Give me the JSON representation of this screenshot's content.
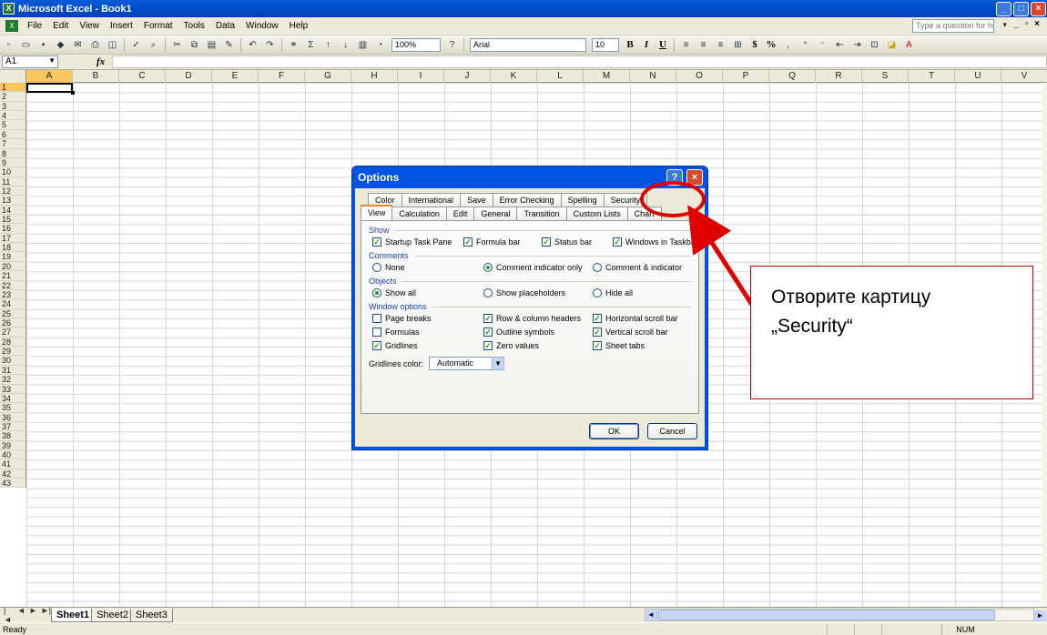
{
  "window": {
    "title": "Microsoft Excel - Book1",
    "app_icon": "X"
  },
  "menu": {
    "items": [
      "File",
      "Edit",
      "View",
      "Insert",
      "Format",
      "Tools",
      "Data",
      "Window",
      "Help"
    ],
    "ask_placeholder": "Type a question for help"
  },
  "toolbar": {
    "zoom": "100%",
    "font": "Arial",
    "size": "10",
    "bold": "B",
    "italic": "I",
    "underline": "U",
    "currency": "$",
    "percent": "%"
  },
  "formula": {
    "cell_ref": "A1",
    "fx": "fx"
  },
  "grid": {
    "columns": [
      "A",
      "B",
      "C",
      "D",
      "E",
      "F",
      "G",
      "H",
      "I",
      "J",
      "K",
      "L",
      "M",
      "N",
      "O",
      "P",
      "Q",
      "R",
      "S",
      "T",
      "U",
      "V"
    ],
    "rows": [
      "1",
      "2",
      "3",
      "4",
      "5",
      "6",
      "7",
      "8",
      "9",
      "10",
      "11",
      "12",
      "13",
      "14",
      "15",
      "16",
      "17",
      "18",
      "19",
      "20",
      "21",
      "22",
      "23",
      "24",
      "25",
      "26",
      "27",
      "28",
      "29",
      "30",
      "31",
      "32",
      "33",
      "34",
      "35",
      "36",
      "37",
      "38",
      "39",
      "40",
      "41",
      "42",
      "43"
    ]
  },
  "sheets": {
    "tabs": [
      "Sheet1",
      "Sheet2",
      "Sheet3"
    ],
    "active": "Sheet1"
  },
  "status": {
    "left": "Ready",
    "num": "NUM"
  },
  "dialog": {
    "title": "Options",
    "tabs_back": [
      "Color",
      "International",
      "Save",
      "Error Checking",
      "Spelling",
      "Security"
    ],
    "tabs_front": [
      "View",
      "Calculation",
      "Edit",
      "General",
      "Transition",
      "Custom Lists",
      "Chart"
    ],
    "show": {
      "label": "Show",
      "startup": "Startup Task Pane",
      "formula_bar": "Formula bar",
      "status_bar": "Status bar",
      "windows_taskbar": "Windows in Taskbar"
    },
    "comments": {
      "label": "Comments",
      "none": "None",
      "indicator_only": "Comment indicator only",
      "comment_indicator": "Comment & indicator"
    },
    "objects": {
      "label": "Objects",
      "show_all": "Show all",
      "placeholders": "Show placeholders",
      "hide_all": "Hide all"
    },
    "window_options": {
      "label": "Window options",
      "page_breaks": "Page breaks",
      "formulas": "Formulas",
      "gridlines": "Gridlines",
      "row_col_headers": "Row & column headers",
      "outline": "Outline symbols",
      "zero_values": "Zero values",
      "h_scroll": "Horizontal scroll bar",
      "v_scroll": "Vertical scroll bar",
      "sheet_tabs": "Sheet tabs"
    },
    "gridlines_color": {
      "label": "Gridlines color:",
      "value": "Automatic"
    },
    "ok": "OK",
    "cancel": "Cancel"
  },
  "annotation": {
    "line1": "Отворите картицу",
    "line2": "„Security“",
    "color": "#e00000"
  }
}
